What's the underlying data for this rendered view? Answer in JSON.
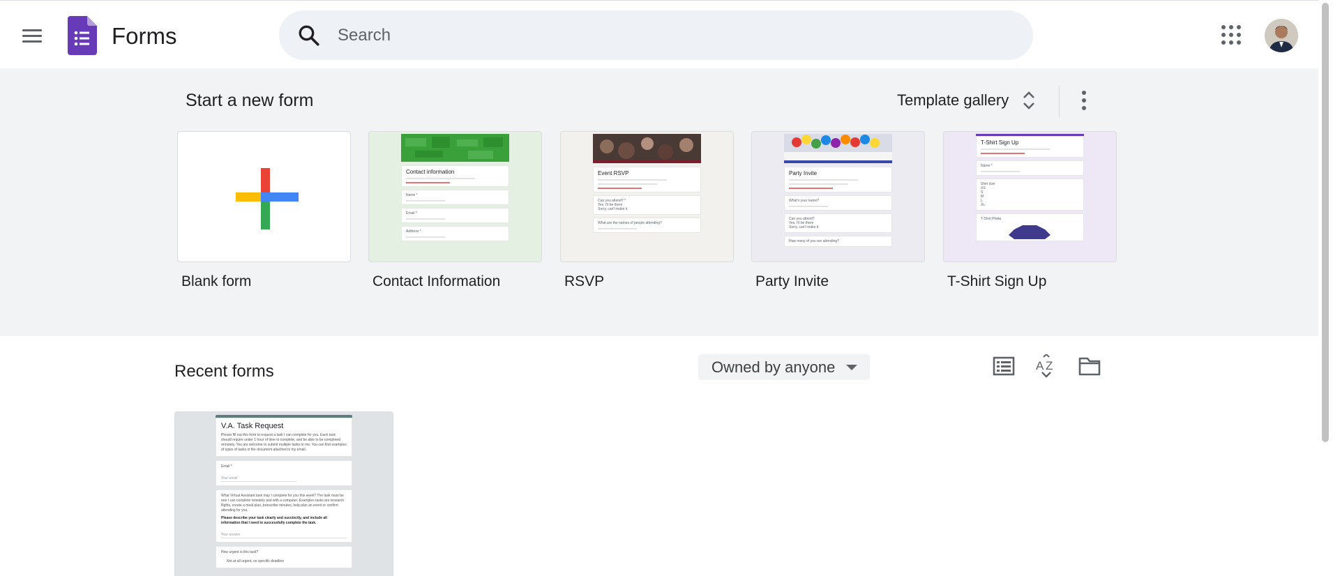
{
  "header": {
    "app_title": "Forms",
    "search_placeholder": "Search",
    "icons": [
      "menu-icon",
      "forms-logo-icon",
      "search-icon",
      "apps-grid-icon",
      "account-avatar"
    ]
  },
  "start": {
    "title": "Start a new form",
    "template_gallery_label": "Template gallery",
    "templates": [
      {
        "label": "Blank form"
      },
      {
        "label": "Contact Information",
        "preview_title": "Contact information",
        "preview_fields": [
          "Name *",
          "Email *",
          "Address *"
        ]
      },
      {
        "label": "RSVP",
        "preview_title": "Event RSVP",
        "preview_questions": [
          "Can you attend? *",
          "Yes, I'll be there",
          "Sorry, can't make it",
          "What are the names of people attending?"
        ]
      },
      {
        "label": "Party Invite",
        "preview_title": "Party Invite",
        "preview_questions": [
          "What's your name?",
          "Can you attend?",
          "Yes, I'll be there",
          "Sorry, can't make it",
          "How many of you are attending?"
        ]
      },
      {
        "label": "T-Shirt Sign Up",
        "preview_title": "T-Shirt Sign Up",
        "preview_fields": [
          "Name *",
          "Shirt size",
          "XS",
          "S",
          "M",
          "L",
          "XL",
          "T-Shirt Photo"
        ]
      }
    ]
  },
  "recent": {
    "title": "Recent forms",
    "owner_filter": "Owned by anyone",
    "view_icons": [
      "list-view-icon",
      "sort-az-icon",
      "folder-icon"
    ],
    "forms": [
      {
        "preview_title": "V.A. Task Request",
        "preview_description": "Please fill out this form to request a task I can complete for you. Each task should require under 1 hour of time to complete, and be able to be completed remotely. You are welcome to submit multiple tasks to me. You can find examples of types of tasks in the document attached to my email.",
        "preview_email_label": "Email *",
        "preview_email_placeholder": "Your email",
        "preview_question_text": "What Virtual Assistant task may I complete for you this week? The task must be one I can complete remotely and with a computer. Examples tasks are research flights, create a meal plan, transcribe minutes, help plan an event or confirm attending for you.",
        "preview_question_bold": "Please describe your task clearly and succinctly, and include all information that I need to successfully complete the task.",
        "preview_answer_placeholder": "Your answer",
        "preview_urgent_label": "How urgent is this task?",
        "preview_urgent_option": "Not at all urgent, no specific deadline"
      }
    ]
  },
  "colors": {
    "forms_purple": "#673ab7",
    "google_red": "#ea4335",
    "google_blue": "#4285f4",
    "google_green": "#34a853",
    "google_yellow": "#fbbc04",
    "section_bg": "#f1f3f4"
  }
}
